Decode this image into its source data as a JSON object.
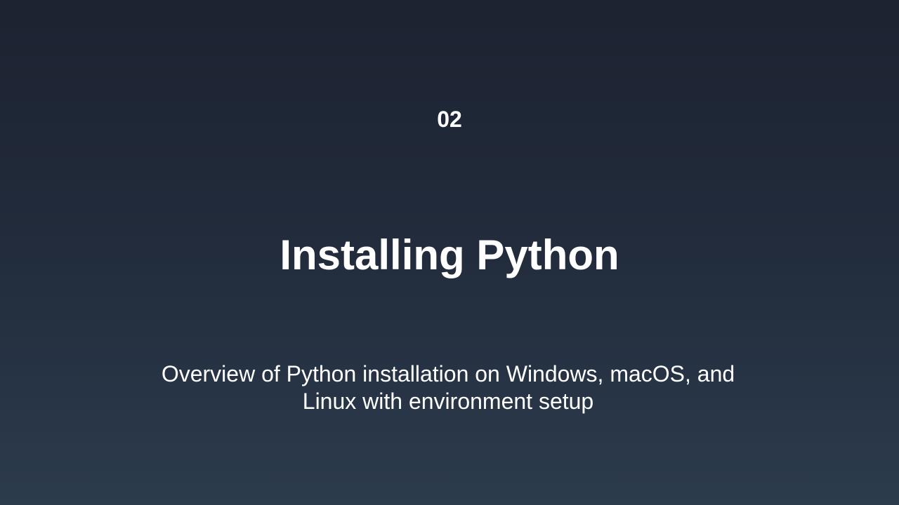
{
  "slide": {
    "section_number": "02",
    "title": "Installing Python",
    "subtitle": "Overview of Python installation on Windows, macOS, and Linux with environment setup"
  },
  "colors": {
    "background_top": "#1c2331",
    "background_bottom": "#2c3b4d",
    "text": "#ffffff"
  }
}
